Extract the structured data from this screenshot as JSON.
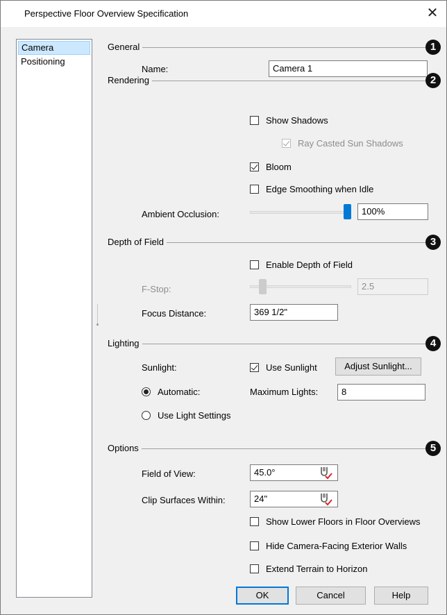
{
  "title": "Perspective Floor Overview Specification",
  "sidebar": {
    "items": [
      {
        "label": "Camera"
      },
      {
        "label": "Positioning"
      }
    ]
  },
  "sections": {
    "general": {
      "title": "General",
      "badge": "1",
      "name_label": "Name:",
      "name_value": "Camera 1"
    },
    "rendering": {
      "title": "Rendering",
      "badge": "2",
      "show_shadows": "Show Shadows",
      "ray_casted": "Ray Casted Sun Shadows",
      "bloom": "Bloom",
      "edge_smoothing": "Edge Smoothing when Idle",
      "ambient_label": "Ambient Occlusion:",
      "ambient_value": "100%",
      "ambient_level": 1.0
    },
    "dof": {
      "title": "Depth of Field",
      "badge": "3",
      "enable": "Enable Depth of Field",
      "fstop_label": "F-Stop:",
      "fstop_value": "2.5",
      "focus_label": "Focus Distance:",
      "focus_value": "369 1/2\""
    },
    "lighting": {
      "title": "Lighting",
      "badge": "4",
      "sunlight_label": "Sunlight:",
      "use_sunlight": "Use Sunlight",
      "adjust_button": "Adjust Sunlight...",
      "automatic": "Automatic:",
      "max_lights_label": "Maximum Lights:",
      "max_lights_value": "8",
      "use_light_settings": "Use Light Settings"
    },
    "options": {
      "title": "Options",
      "badge": "5",
      "fov_label": "Field of View:",
      "fov_value": "45.0°",
      "clip_label": "Clip Surfaces Within:",
      "clip_value": "24\"",
      "show_lower": "Show Lower Floors in Floor Overviews",
      "hide_walls": "Hide Camera-Facing Exterior Walls",
      "extend_terrain": "Extend Terrain to Horizon"
    }
  },
  "buttons": {
    "ok": "OK",
    "cancel": "Cancel",
    "help": "Help"
  },
  "state": {
    "show_shadows": false,
    "ray_casted": true,
    "bloom": true,
    "edge_smoothing": false,
    "enable_dof": false,
    "use_sunlight": true,
    "lighting_mode": "automatic",
    "show_lower": false,
    "hide_walls": false,
    "extend_terrain": false
  },
  "icons": {
    "close": "close-icon",
    "calc": "calculator-icon"
  },
  "colors": {
    "accent": "#0078d7",
    "selection": "#cce8ff",
    "badge": "#111111"
  }
}
